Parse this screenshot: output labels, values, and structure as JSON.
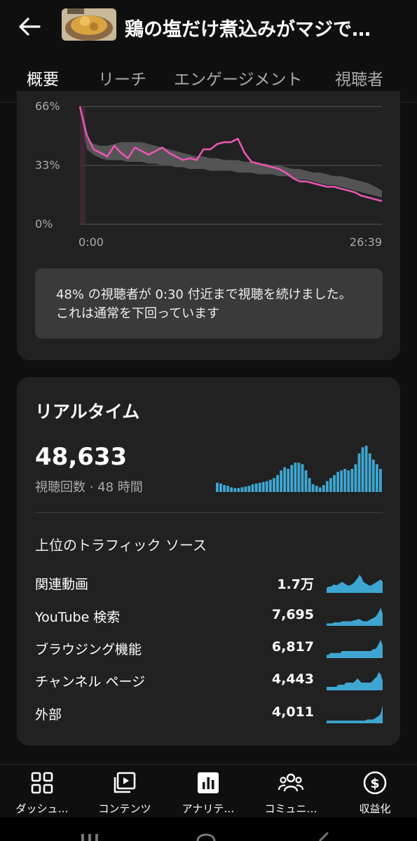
{
  "header": {
    "title": "鶏の塩だけ煮込みがマジで…",
    "back_icon": "arrow-left-icon",
    "thumbnail_icon": "video-thumbnail"
  },
  "tabs": [
    {
      "label": "概要",
      "active": true
    },
    {
      "label": "リーチ",
      "active": false
    },
    {
      "label": "エンゲージメント",
      "active": false
    },
    {
      "label": "視聴者",
      "active": false
    }
  ],
  "retention": {
    "y_ticks": [
      "66%",
      "33%",
      "0%"
    ],
    "x_start": "0:00",
    "x_end": "26:39",
    "insight": "48% の視聴者が 0:30 付近まで視聴を続けました。これは通常を下回っています",
    "line_color": "#e657b2"
  },
  "chart_data": {
    "type": "line",
    "x_unit": "video time",
    "x_labels": [
      "0:00",
      "26:39"
    ],
    "y_ticks": [
      "0%",
      "33%",
      "66%"
    ],
    "ylim": [
      0,
      66
    ],
    "series": [
      {
        "values": [
          66,
          50,
          42,
          40,
          38,
          44,
          40,
          37,
          43,
          41,
          39,
          41,
          43,
          40,
          38,
          36,
          37,
          36,
          42,
          42,
          45,
          46,
          46,
          48,
          40,
          35,
          34,
          33,
          32,
          31,
          29,
          26,
          24,
          24,
          23,
          22,
          21,
          21,
          20,
          19,
          18,
          16,
          15,
          14,
          13
        ]
      },
      {
        "band_upper": [
          66,
          48,
          45,
          44,
          44,
          45,
          46,
          46,
          46,
          46,
          45,
          44,
          43,
          42,
          41,
          40,
          39,
          38,
          38,
          37,
          37,
          36,
          36,
          36,
          35,
          35,
          34,
          34,
          33,
          33,
          32,
          31,
          31,
          30,
          29,
          29,
          28,
          27,
          27,
          26,
          25,
          24,
          23,
          21,
          19
        ],
        "band_lower": [
          66,
          42,
          39,
          37,
          36,
          36,
          36,
          35,
          35,
          35,
          34,
          34,
          33,
          33,
          32,
          32,
          31,
          31,
          31,
          30,
          30,
          30,
          30,
          29,
          29,
          29,
          28,
          28,
          28,
          27,
          27,
          26,
          25,
          25,
          24,
          23,
          22,
          22,
          21,
          20,
          19,
          18,
          17,
          16,
          15
        ]
      }
    ]
  },
  "realtime": {
    "title": "リアルタイム",
    "count": "48,633",
    "subtitle": "視聴回数 · 48 時間",
    "bar_color": "#3ea6d1",
    "bars": [
      12,
      11,
      9,
      8,
      6,
      5,
      5,
      6,
      7,
      8,
      10,
      11,
      12,
      13,
      14,
      16,
      18,
      22,
      28,
      32,
      30,
      35,
      38,
      38,
      36,
      28,
      18,
      10,
      8,
      6,
      9,
      14,
      18,
      22,
      26,
      28,
      30,
      28,
      30,
      36,
      50,
      58,
      60,
      50,
      42,
      36,
      30
    ]
  },
  "traffic": {
    "title": "上位のトラフィック ソース",
    "sources": [
      {
        "label": "関連動画",
        "value": "1.7万",
        "spark": [
          3,
          4,
          4,
          5,
          6,
          5,
          6,
          7,
          8,
          7,
          6,
          5,
          5,
          6,
          7,
          9,
          11,
          14,
          12,
          8,
          7,
          6,
          5,
          5,
          6,
          7,
          8,
          9,
          10,
          8
        ]
      },
      {
        "label": "YouTube 検索",
        "value": "7,695",
        "spark": [
          1,
          1,
          1,
          1,
          2,
          2,
          2,
          2,
          3,
          3,
          3,
          3,
          3,
          3,
          4,
          4,
          5,
          5,
          4,
          3,
          3,
          3,
          4,
          5,
          6,
          7,
          9,
          12,
          16,
          10
        ]
      },
      {
        "label": "ブラウジング機能",
        "value": "6,817",
        "spark": [
          1,
          1,
          2,
          2,
          2,
          2,
          2,
          2,
          3,
          3,
          3,
          3,
          3,
          3,
          3,
          3,
          3,
          3,
          3,
          3,
          3,
          3,
          3,
          3,
          4,
          4,
          5,
          7,
          9,
          6
        ]
      },
      {
        "label": "チャンネル ページ",
        "value": "4,443",
        "spark": [
          1,
          1,
          1,
          1,
          1,
          1,
          2,
          2,
          2,
          2,
          3,
          3,
          3,
          3,
          3,
          4,
          5,
          4,
          3,
          3,
          3,
          3,
          3,
          3,
          4,
          5,
          6,
          8,
          7,
          4
        ]
      },
      {
        "label": "外部",
        "value": "4,011",
        "spark": [
          1,
          1,
          1,
          1,
          1,
          1,
          1,
          1,
          1,
          1,
          1,
          1,
          1,
          1,
          1,
          1,
          1,
          1,
          1,
          1,
          1,
          2,
          2,
          2,
          2,
          3,
          4,
          5,
          7,
          14
        ]
      }
    ]
  },
  "bottom_nav": [
    {
      "label": "ダッシュ…",
      "icon": "dashboard-icon"
    },
    {
      "label": "コンテンツ",
      "icon": "content-icon"
    },
    {
      "label": "アナリテ…",
      "icon": "analytics-icon"
    },
    {
      "label": "コミュニ…",
      "icon": "community-icon"
    },
    {
      "label": "収益化",
      "icon": "monetization-icon"
    }
  ]
}
